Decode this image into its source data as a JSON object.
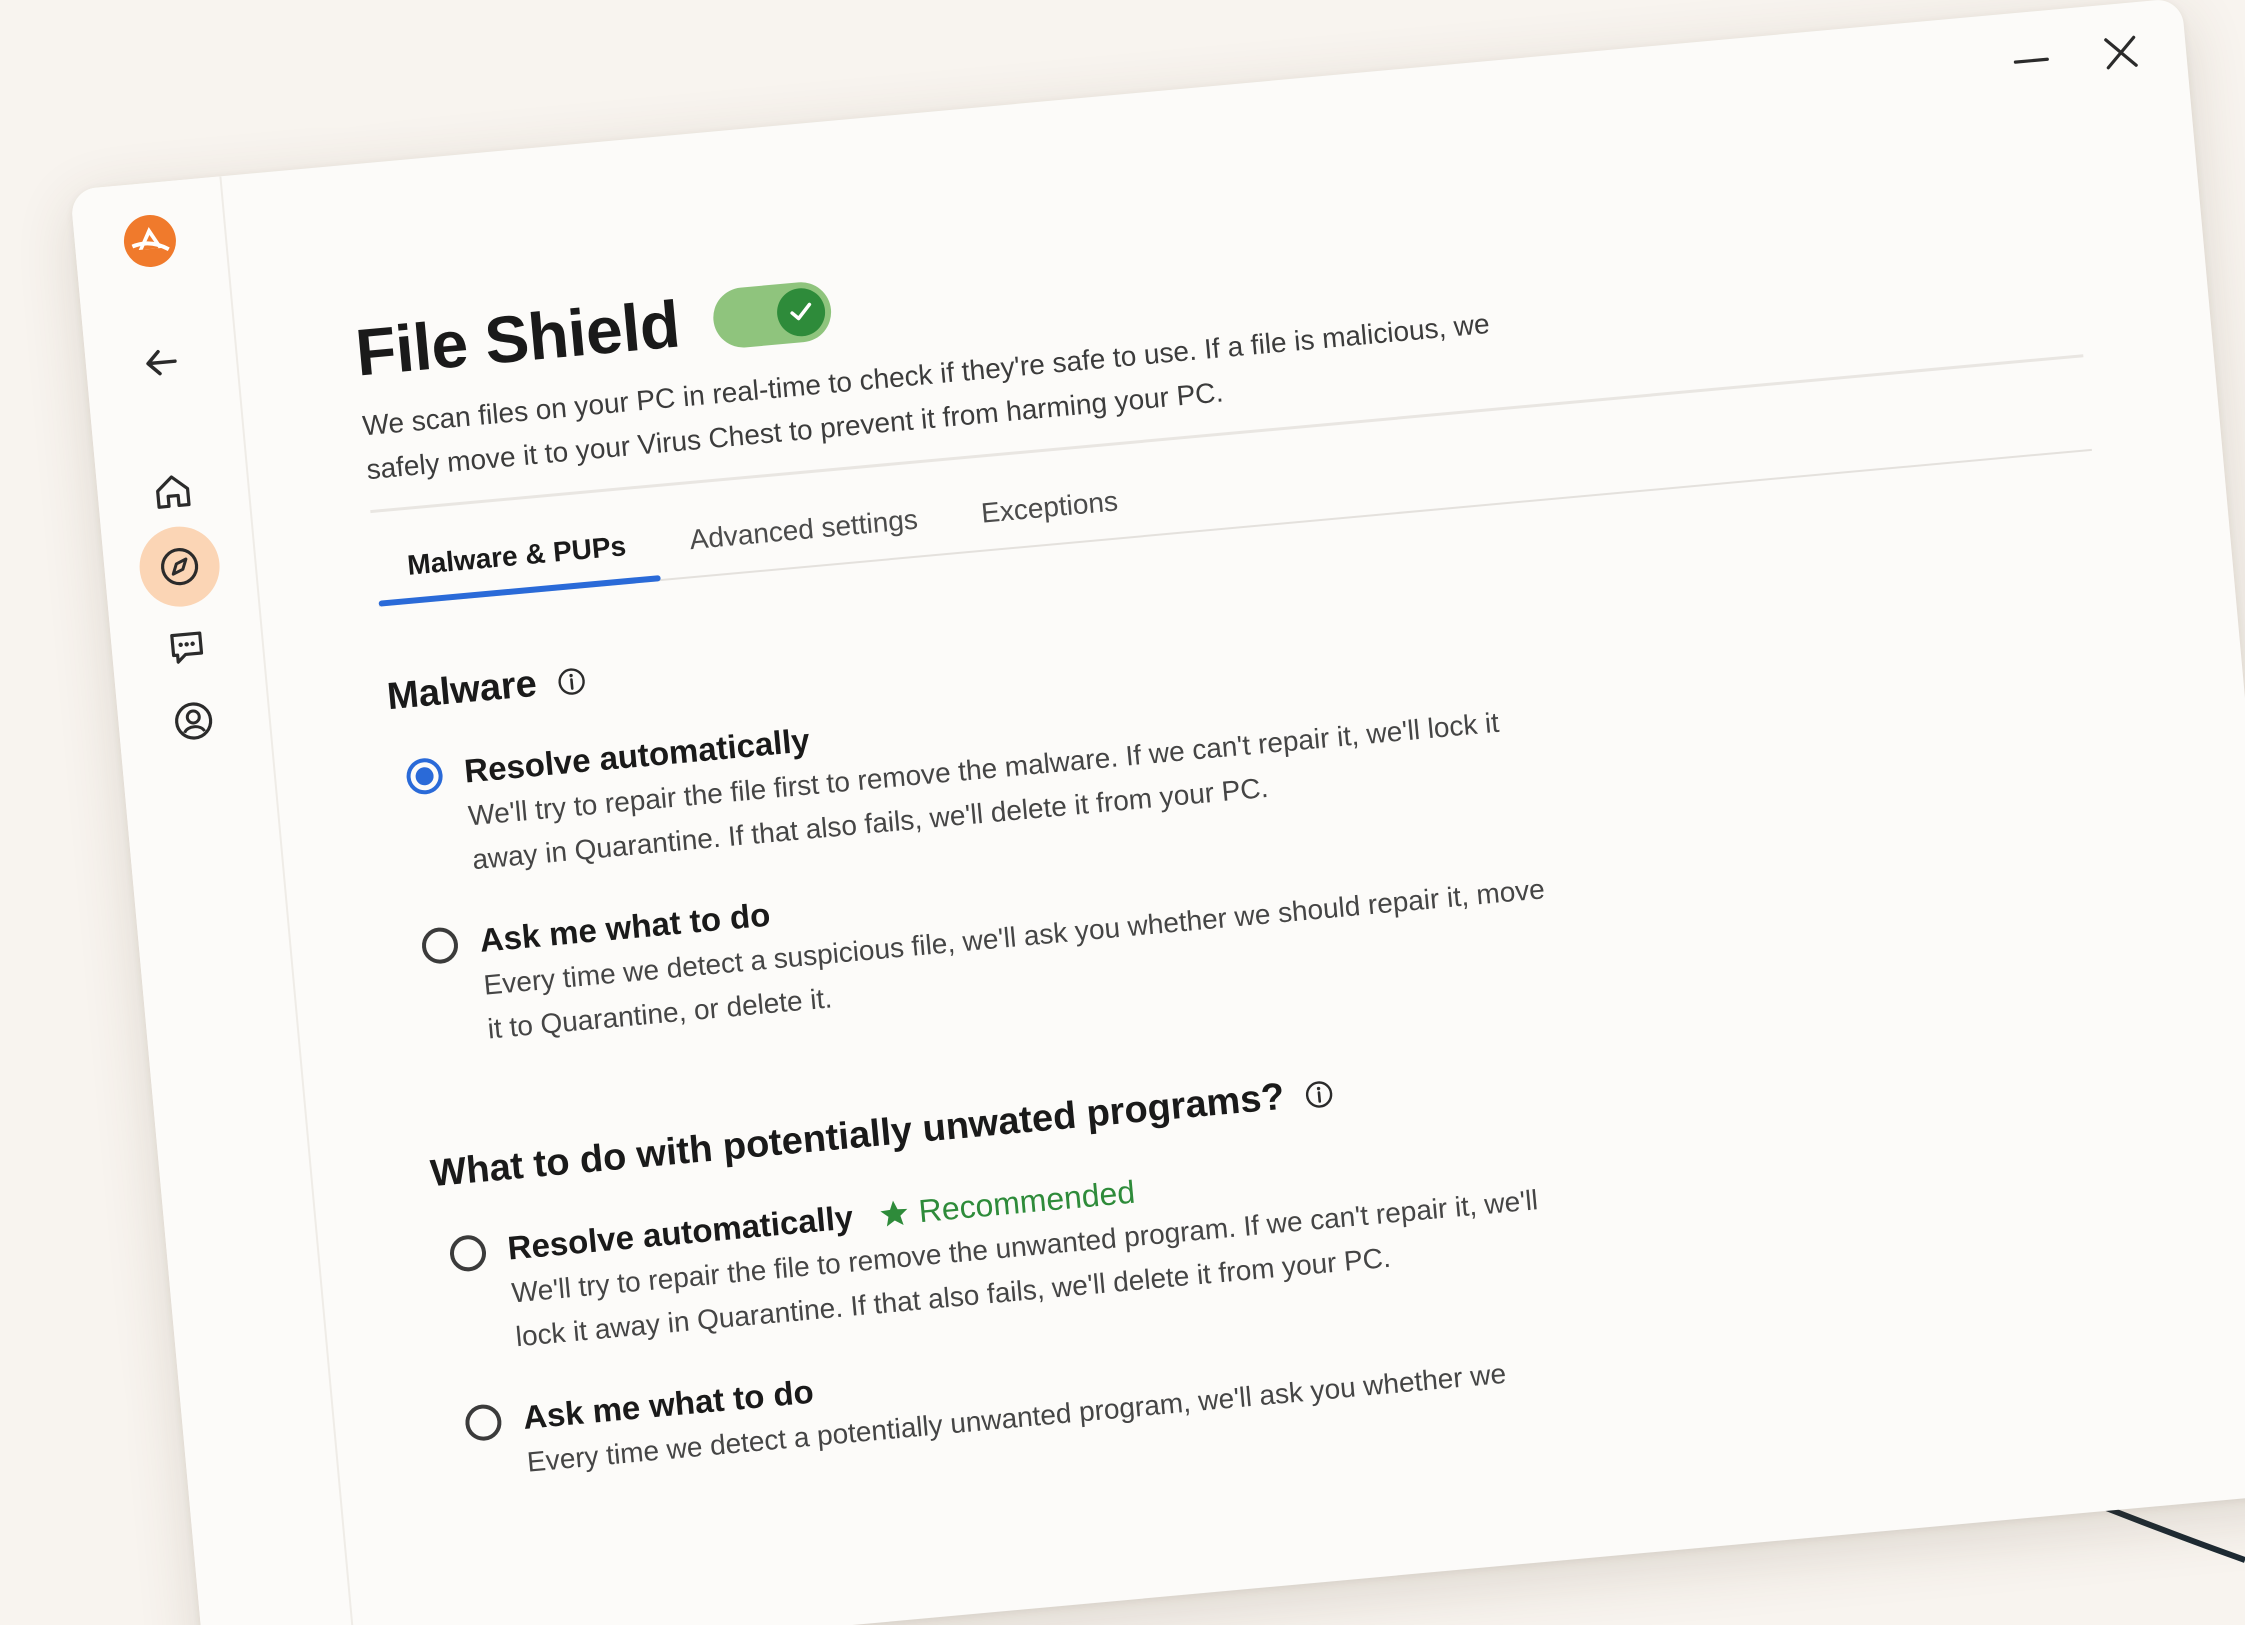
{
  "window": {
    "minimize_icon": "minimize-icon",
    "close_icon": "close-icon"
  },
  "sidebar": {
    "items": [
      {
        "name": "logo",
        "icon": "brand-logo-icon"
      },
      {
        "name": "back",
        "icon": "back-arrow-icon"
      },
      {
        "name": "home",
        "icon": "home-icon"
      },
      {
        "name": "explore",
        "icon": "compass-icon",
        "active": true
      },
      {
        "name": "chat",
        "icon": "chat-bubble-icon"
      },
      {
        "name": "account",
        "icon": "account-icon"
      }
    ]
  },
  "header": {
    "title": "File Shield",
    "toggle_on": true,
    "description": "We scan files on your PC in real-time to check if they're safe to use. If a file is malicious, we safely move it to your Virus Chest to prevent it from harming your PC."
  },
  "tabs": [
    {
      "label": "Malware & PUPs",
      "active": true
    },
    {
      "label": "Advanced settings",
      "active": false
    },
    {
      "label": "Exceptions",
      "active": false
    }
  ],
  "malware": {
    "title": "Malware",
    "options": [
      {
        "label": "Resolve automatically",
        "description": "We'll try to repair the file first to remove the malware. If we can't repair it, we'll lock it away in Quarantine. If that also fails, we'll delete it from your PC.",
        "selected": true
      },
      {
        "label": "Ask me what to do",
        "description": "Every time we detect a suspicious file, we'll ask you whether we should repair it, move it to Quarantine, or delete it.",
        "selected": false
      }
    ]
  },
  "pups": {
    "title": "What to do with potentially unwated programs?",
    "recommended_label": "Recommended",
    "options": [
      {
        "label": "Resolve automatically",
        "description": "We'll try to repair the file to remove the unwanted program. If we can't repair it, we'll lock it away in Quarantine. If that also fails, we'll delete it from your PC.",
        "selected": false
      },
      {
        "label": "Ask me what to do",
        "description": "Every time we detect a potentially unwanted program, we'll ask you whether we",
        "selected": false
      }
    ]
  },
  "colors": {
    "accent": "#2a6ad8",
    "toggle_track": "#8fc47d",
    "toggle_knob": "#2e8b3a",
    "recommended": "#2e8b3a",
    "brand": "#f07a2c",
    "active_nav": "#fbd5b5"
  }
}
